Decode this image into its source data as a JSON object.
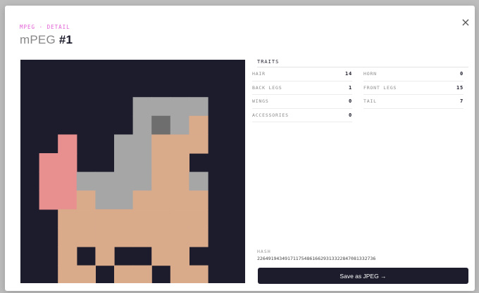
{
  "modal": {
    "eyebrow": "MPEG · DETAIL",
    "title_prefix": "mPEG",
    "title_number": "#1",
    "close_glyph": "×"
  },
  "traits": {
    "tab_label": "TRAITS",
    "left": [
      {
        "label": "HAIR",
        "value": "14"
      },
      {
        "label": "BACK LEGS",
        "value": "1"
      },
      {
        "label": "WINGS",
        "value": "0"
      },
      {
        "label": "ACCESSORIES",
        "value": "0"
      }
    ],
    "right": [
      {
        "label": "HORN",
        "value": "0"
      },
      {
        "label": "FRONT LEGS",
        "value": "15"
      },
      {
        "label": "TAIL",
        "value": "7"
      }
    ]
  },
  "hash": {
    "label": "HASH",
    "value": "2264919434917117548616629313322847081332736"
  },
  "save_button": {
    "label": "Save as JPEG →"
  },
  "colors": {
    "background": "#1c1c2c",
    "skin": "#d9ab8b",
    "hair": "#a6a6a6",
    "eye": "#6e6e6e",
    "wing": "#e89090"
  }
}
